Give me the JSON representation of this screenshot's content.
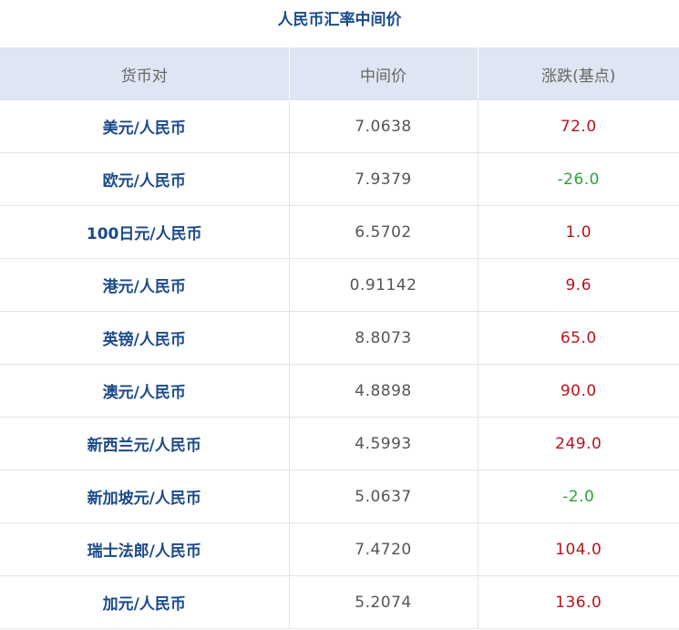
{
  "title": "人民币汇率中间价",
  "columns": {
    "pair": "货币对",
    "mid": "中间价",
    "change": "涨跌(基点)"
  },
  "colors": {
    "title": "#1a4a8a",
    "header_bg": "#dfe5f2",
    "up": "#b8141c",
    "down": "#2aa33a"
  },
  "rows": [
    {
      "pair": "美元/人民币",
      "mid": "7.0638",
      "change": "72.0",
      "dir": "up"
    },
    {
      "pair": "欧元/人民币",
      "mid": "7.9379",
      "change": "-26.0",
      "dir": "down"
    },
    {
      "pair": "100日元/人民币",
      "mid": "6.5702",
      "change": "1.0",
      "dir": "up"
    },
    {
      "pair": "港元/人民币",
      "mid": "0.91142",
      "change": "9.6",
      "dir": "up"
    },
    {
      "pair": "英镑/人民币",
      "mid": "8.8073",
      "change": "65.0",
      "dir": "up"
    },
    {
      "pair": "澳元/人民币",
      "mid": "4.8898",
      "change": "90.0",
      "dir": "up"
    },
    {
      "pair": "新西兰元/人民币",
      "mid": "4.5993",
      "change": "249.0",
      "dir": "up"
    },
    {
      "pair": "新加坡元/人民币",
      "mid": "5.0637",
      "change": "-2.0",
      "dir": "down"
    },
    {
      "pair": "瑞士法郎/人民币",
      "mid": "7.4720",
      "change": "104.0",
      "dir": "up"
    },
    {
      "pair": "加元/人民币",
      "mid": "5.2074",
      "change": "136.0",
      "dir": "up"
    }
  ]
}
